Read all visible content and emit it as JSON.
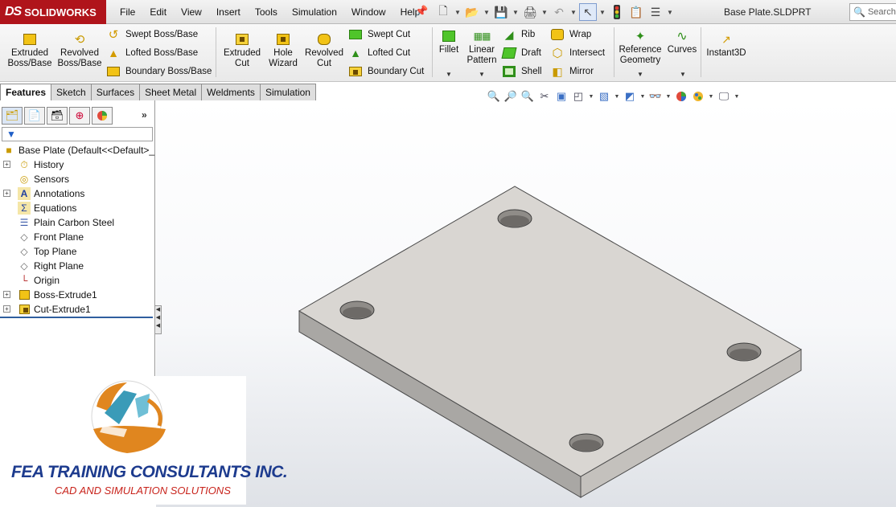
{
  "app": {
    "logo_text": "SOLIDWORKS",
    "logo_mark": "DS",
    "document_title": "Base Plate.SLDPRT"
  },
  "menu": [
    "File",
    "Edit",
    "View",
    "Insert",
    "Tools",
    "Simulation",
    "Window",
    "Help"
  ],
  "search": {
    "placeholder": "Search"
  },
  "commands": {
    "extruded_boss": "Extruded Boss/Base",
    "revolved_boss": "Revolved Boss/Base",
    "swept_boss": "Swept Boss/Base",
    "lofted_boss": "Lofted Boss/Base",
    "boundary_boss": "Boundary Boss/Base",
    "extruded_cut": "Extruded Cut",
    "hole_wizard": "Hole Wizard",
    "revolved_cut": "Revolved Cut",
    "swept_cut": "Swept Cut",
    "lofted_cut": "Lofted Cut",
    "boundary_cut": "Boundary Cut",
    "fillet": "Fillet",
    "linear_pattern": "Linear Pattern",
    "rib": "Rib",
    "draft": "Draft",
    "shell": "Shell",
    "wrap": "Wrap",
    "intersect": "Intersect",
    "mirror": "Mirror",
    "reference_geometry": "Reference Geometry",
    "curves": "Curves",
    "instant3d": "Instant3D"
  },
  "tabs": [
    "Features",
    "Sketch",
    "Surfaces",
    "Sheet Metal",
    "Weldments",
    "Simulation"
  ],
  "active_tab": "Features",
  "feature_tree": {
    "root": "Base Plate  (Default<<Default>_",
    "items": [
      {
        "label": "History",
        "icon": "history-icon",
        "expandable": true
      },
      {
        "label": "Sensors",
        "icon": "sensor-icon",
        "expandable": false
      },
      {
        "label": "Annotations",
        "icon": "annotation-icon",
        "expandable": true
      },
      {
        "label": "Equations",
        "icon": "equation-icon",
        "expandable": false
      },
      {
        "label": "Plain Carbon Steel",
        "icon": "material-icon",
        "expandable": false
      },
      {
        "label": "Front Plane",
        "icon": "plane-icon",
        "expandable": false
      },
      {
        "label": "Top Plane",
        "icon": "plane-icon",
        "expandable": false
      },
      {
        "label": "Right Plane",
        "icon": "plane-icon",
        "expandable": false
      },
      {
        "label": "Origin",
        "icon": "origin-icon",
        "expandable": false
      },
      {
        "label": "Boss-Extrude1",
        "icon": "boss-extrude-icon",
        "expandable": true
      },
      {
        "label": "Cut-Extrude1",
        "icon": "cut-extrude-icon",
        "expandable": true
      }
    ]
  },
  "brand": {
    "name": "FEA TRAINING  CONSULTANTS INC.",
    "tagline": "CAD AND SIMULATION SOLUTIONS",
    "colors": {
      "blue": "#1d3b8e",
      "orange": "#e0861f",
      "teal": "#3a9bb8",
      "red": "#c8231b"
    }
  },
  "colors": {
    "logo_bg": "#b0141b",
    "plate_top": "#d9d6d2",
    "plate_side": "#a9a7a4"
  }
}
